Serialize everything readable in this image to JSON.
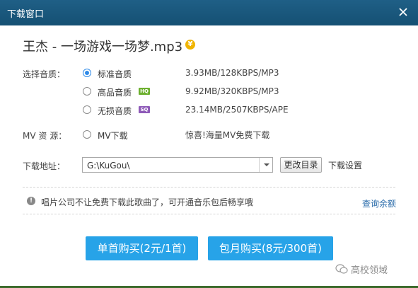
{
  "window": {
    "title": "下载窗口"
  },
  "song": {
    "title": "王杰 - 一场游戏一场梦.mp3",
    "coin_symbol": "¥"
  },
  "quality": {
    "label": "选择音质：",
    "options": [
      {
        "label": "标准音质",
        "badge": "",
        "info": "3.93MB/128KBPS/MP3",
        "selected": true
      },
      {
        "label": "高品音质",
        "badge": "HQ",
        "info": "9.92MB/320KBPS/MP3",
        "selected": false
      },
      {
        "label": "无损音质",
        "badge": "SQ",
        "info": "23.14MB/2507KBPS/APE",
        "selected": false
      }
    ]
  },
  "mv": {
    "label": "MV 资 源：",
    "option": "MV下载",
    "info": "惊喜!海量MV免费下载",
    "selected": false
  },
  "download": {
    "label": "下载地址：",
    "path": "G:\\KuGou\\",
    "change_button": "更改目录",
    "settings_link": "下载设置"
  },
  "notice": {
    "text": "唱片公司不让免费下载此歌曲了，可开通音乐包后畅享哦",
    "link": "查询余额"
  },
  "buttons": {
    "single": "单首购买(2元/1首)",
    "monthly": "包月购买(8元/300首)"
  },
  "watermark": "高校领域",
  "colors": {
    "titlebar": "#1a5a80",
    "primary_button": "#27a3e8",
    "link": "#2568a8",
    "radio_selected": "#2f8be8"
  }
}
